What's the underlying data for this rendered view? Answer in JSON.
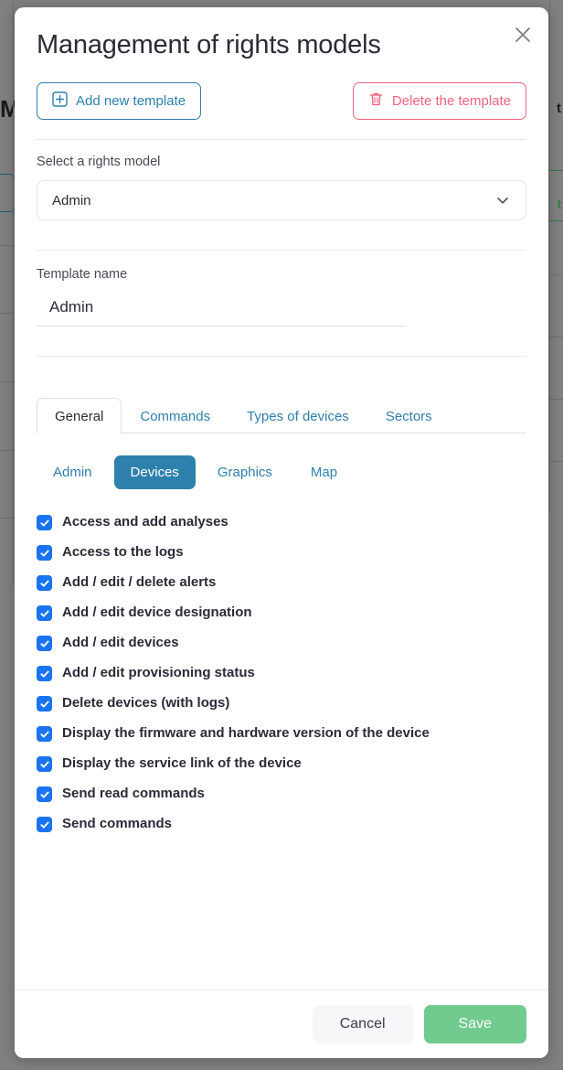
{
  "background": {
    "title_fragment": "MP",
    "right_fragment": "t",
    "green_fragment": "t"
  },
  "modal": {
    "title": "Management of rights models",
    "close_icon": "close-icon",
    "actions": {
      "add": {
        "label": "Add new template",
        "icon": "plus-square-icon",
        "color": "#2e80ad"
      },
      "delete": {
        "label": "Delete the template",
        "icon": "trash-icon",
        "color": "#f2647e"
      }
    },
    "select_section": {
      "label": "Select a rights model",
      "value": "Admin",
      "chevron_icon": "chevron-down-icon"
    },
    "template_name": {
      "label": "Template name",
      "value": "Admin",
      "placeholder": "Template name"
    },
    "tabs": [
      {
        "label": "General",
        "active": true
      },
      {
        "label": "Commands",
        "active": false
      },
      {
        "label": "Types of devices",
        "active": false
      },
      {
        "label": "Sectors",
        "active": false
      }
    ],
    "pills": [
      {
        "label": "Admin",
        "active": false
      },
      {
        "label": "Devices",
        "active": true
      },
      {
        "label": "Graphics",
        "active": false
      },
      {
        "label": "Map",
        "active": false
      }
    ],
    "permissions": [
      {
        "label": "Access and add analyses",
        "checked": true
      },
      {
        "label": "Access to the logs",
        "checked": true
      },
      {
        "label": "Add / edit / delete alerts",
        "checked": true
      },
      {
        "label": "Add / edit device designation",
        "checked": true
      },
      {
        "label": "Add / edit devices",
        "checked": true
      },
      {
        "label": "Add / edit provisioning status",
        "checked": true
      },
      {
        "label": "Delete devices (with logs)",
        "checked": true
      },
      {
        "label": "Display the firmware and hardware version of the device",
        "checked": true
      },
      {
        "label": "Display the service link of the device",
        "checked": true
      },
      {
        "label": "Send read commands",
        "checked": true
      },
      {
        "label": "Send commands",
        "checked": true
      }
    ],
    "footer": {
      "cancel_label": "Cancel",
      "save_label": "Save",
      "save_color": "#71cb8f"
    }
  }
}
